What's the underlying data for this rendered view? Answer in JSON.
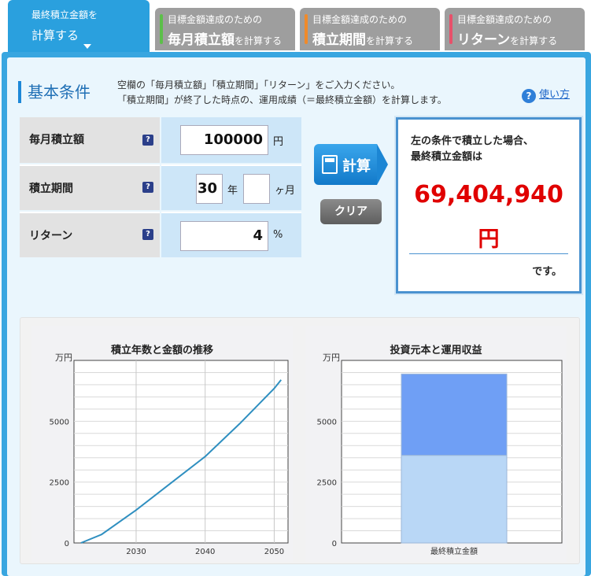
{
  "tabs": [
    {
      "line1": "最終積立金額",
      "line1_small": "を",
      "line2": "計算する",
      "active": true
    },
    {
      "sub": "目標金額達成のための",
      "main_bold": "毎月積立額",
      "main_rest": "を計算する",
      "color": "#5cbf4a"
    },
    {
      "sub": "目標金額達成のための",
      "main_bold": "積立期間",
      "main_rest": "を計算する",
      "color": "#f08a2a"
    },
    {
      "sub": "目標金額達成のための",
      "main_bold": "リターン",
      "main_rest": "を計算する",
      "color": "#e8506a"
    }
  ],
  "section": {
    "title": "基本条件",
    "desc_line1": "空欄の「毎月積立額」「積立期間」「リターン」をご入力ください。",
    "desc_line2": "「積立期間」が終了した時点の、運用成績（＝最終積立金額）を計算します。",
    "help_label": "使い方",
    "help_icon": "?"
  },
  "form": {
    "monthly": {
      "label": "毎月積立額",
      "value": "100000",
      "unit": "円",
      "help": "?"
    },
    "period": {
      "label": "積立期間",
      "years": "30",
      "years_unit": "年",
      "months": "",
      "months_unit": "ヶ月",
      "help": "?"
    },
    "return": {
      "label": "リターン",
      "value": "4",
      "unit": "%",
      "help": "?"
    }
  },
  "buttons": {
    "calc": "計算",
    "clear": "クリア"
  },
  "result": {
    "line1": "左の条件で積立した場合、",
    "line2": "最終積立金額は",
    "amount": "69,404,940",
    "yen": "円",
    "suffix": "です。"
  },
  "chart_data": [
    {
      "type": "line",
      "title": "積立年数と金額の推移",
      "ylabel": "万円",
      "x": [
        2022,
        2025,
        2030,
        2035,
        2040,
        2045,
        2050,
        2051
      ],
      "series": [
        {
          "values": [
            0,
            350,
            1350,
            2450,
            3550,
            4900,
            6350,
            6700
          ],
          "color": "#2f8fc0"
        }
      ],
      "xlim": [
        2021,
        2052
      ],
      "ylim": [
        0,
        7500
      ],
      "xticks": [
        "2030",
        "2040",
        "2050"
      ],
      "yticks": [
        "0",
        "2500",
        "5000"
      ],
      "grid": true
    },
    {
      "type": "bar",
      "title": "投資元本と運用収益",
      "ylabel": "万円",
      "categories": [
        "最終積立金額"
      ],
      "series": [
        {
          "values": [
            3600
          ],
          "color": "#b9d7f6"
        },
        {
          "values": [
            3340
          ],
          "color": "#6f9ff5"
        }
      ],
      "stacked": true,
      "ylim": [
        0,
        7500
      ],
      "yticks": [
        "0",
        "2500",
        "5000"
      ],
      "grid": true
    }
  ]
}
